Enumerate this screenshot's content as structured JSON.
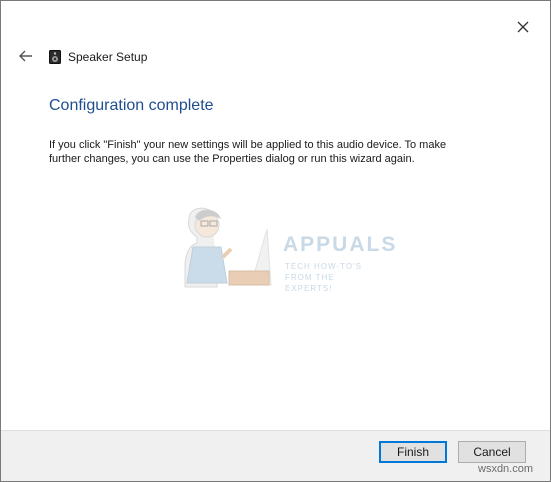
{
  "window": {
    "title": "Speaker Setup"
  },
  "icons": {
    "close": "close-icon",
    "back": "back-arrow-icon",
    "app": "speaker-icon"
  },
  "main": {
    "heading": "Configuration complete",
    "body": "If you click \"Finish\" your new settings will be applied to this audio device.  To make further changes, you can use the Properties dialog or run this wizard again."
  },
  "watermark": {
    "logo": "APPUALS",
    "tagline": "TECH HOW-TO'S FROM THE EXPERTS!"
  },
  "footer": {
    "finish_label": "Finish",
    "cancel_label": "Cancel"
  },
  "site_mark": "wsxdn.com",
  "colors": {
    "heading": "#1f4e91",
    "primary_border": "#0078d7",
    "footer_bg": "#f0f0f0"
  }
}
